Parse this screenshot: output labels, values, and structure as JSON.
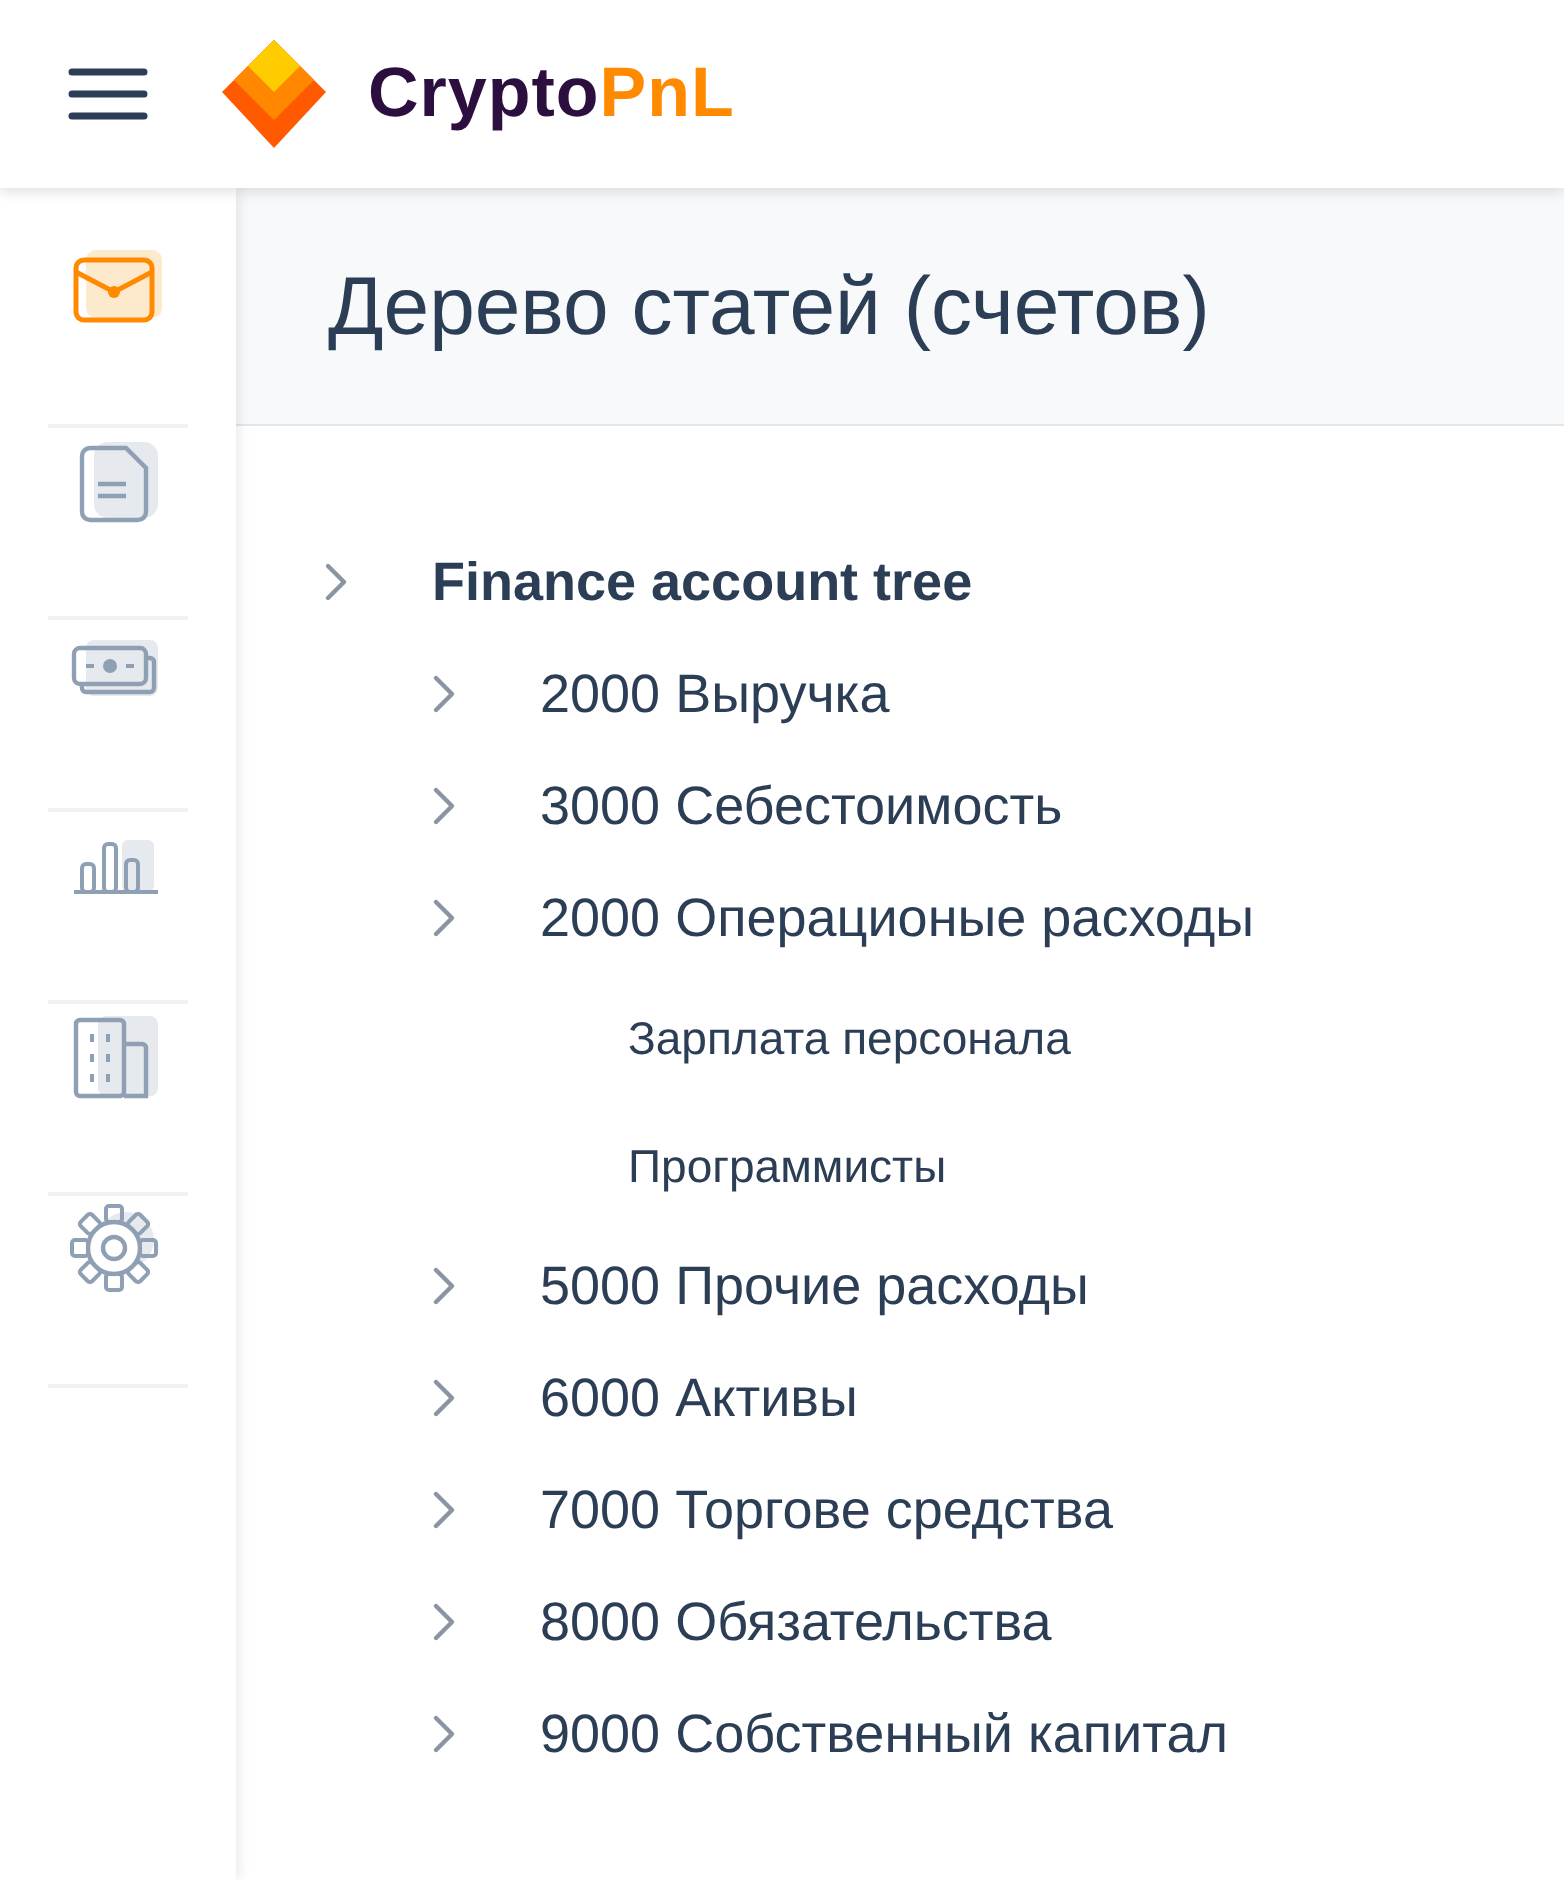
{
  "header": {
    "logo": {
      "text": "Crypto",
      "accent": "PnL"
    }
  },
  "sidebar": {
    "items": [
      {
        "kind": "wallet",
        "selected": true
      },
      {
        "kind": "document",
        "selected": false
      },
      {
        "kind": "money",
        "selected": false
      },
      {
        "kind": "chart",
        "selected": false
      },
      {
        "kind": "building",
        "selected": false
      },
      {
        "kind": "settings",
        "selected": false
      }
    ]
  },
  "page": {
    "title": "Дерево статей (счетов)"
  },
  "tree": {
    "label": "Finance account tree",
    "children": [
      {
        "code": "2000",
        "label": "Выручка"
      },
      {
        "code": "3000",
        "label": "Себестоимость"
      },
      {
        "code": "2000",
        "label": "Операционые расходы",
        "children": [
          {
            "label": "Зарплата персонала"
          },
          {
            "label": "Программисты"
          }
        ]
      },
      {
        "code": "5000",
        "label": "Прочие расходы"
      },
      {
        "code": "6000",
        "label": "Активы"
      },
      {
        "code": "7000",
        "label": "Торгове средства"
      },
      {
        "code": "8000",
        "label": "Обязательства"
      },
      {
        "code": "9000",
        "label": "Собственный капитал"
      }
    ]
  }
}
